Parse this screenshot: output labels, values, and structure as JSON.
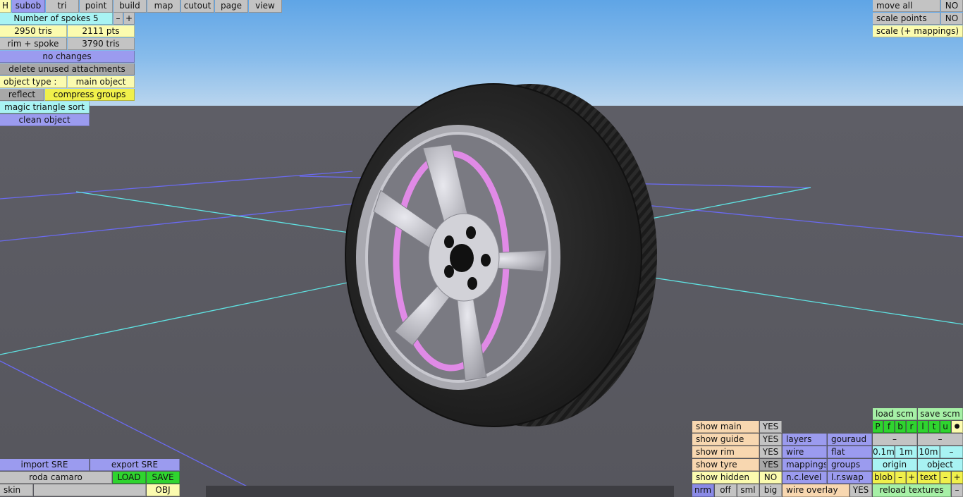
{
  "menu": {
    "help": "H",
    "tabs": [
      "subob",
      "tri",
      "point",
      "build",
      "map",
      "cutout",
      "page",
      "view"
    ],
    "active": "subob"
  },
  "left_panel": {
    "spokes_label": "Number of spokes 5",
    "minus": "–",
    "plus": "+",
    "tris": "2950 tris",
    "pts": "2111 pts",
    "rim_spoke": "rim + spoke",
    "rim_spoke_tris": "3790 tris",
    "no_changes": "no changes",
    "delete_unused": "delete unused attachments",
    "object_type_label": "object type :",
    "object_type_value": "main object",
    "reflect": "reflect",
    "compress_groups": "compress groups",
    "magic_sort": "magic triangle sort",
    "clean_object": "clean object"
  },
  "top_right": {
    "move_all": "move all",
    "move_all_value": "NO",
    "scale_points": "scale points",
    "scale_points_value": "NO",
    "scale_mappings": "scale (+ mappings)"
  },
  "bottom_left": {
    "import_sre": "import SRE",
    "export_sre": "export SRE",
    "file_name": "roda camaro",
    "load": "LOAD",
    "save": "SAVE",
    "skin": "skin",
    "obj": "OBJ"
  },
  "bottom_right": {
    "show_main": "show main",
    "show_main_value": "YES",
    "show_guide": "show guide",
    "show_guide_value": "YES",
    "show_rim": "show rim",
    "show_rim_value": "YES",
    "show_tyre": "show tyre",
    "show_tyre_value": "YES",
    "show_hidden": "show hidden",
    "show_hidden_value": "NO",
    "layers": "layers",
    "gouraud": "gouraud",
    "wire": "wire",
    "flat": "flat",
    "mappings": "mappings",
    "groups": "groups",
    "nc_level": "n.c.level",
    "lr_swap": "l.r.swap",
    "nrm": "nrm",
    "off": "off",
    "sml": "sml",
    "big": "big",
    "wire_overlay": "wire overlay",
    "wire_overlay_value": "YES",
    "load_scm": "load scm",
    "save_scm": "save scm",
    "flags": [
      "P",
      "f",
      "b",
      "r",
      "l",
      "t",
      "u"
    ],
    "flag_dot": "●",
    "dash": "–",
    "step_01": "0.1m",
    "step_1": "1m",
    "step_10": "10m",
    "origin": "origin",
    "object": "object",
    "blob": "blob",
    "text": "text",
    "reload_textures": "reload textures"
  }
}
